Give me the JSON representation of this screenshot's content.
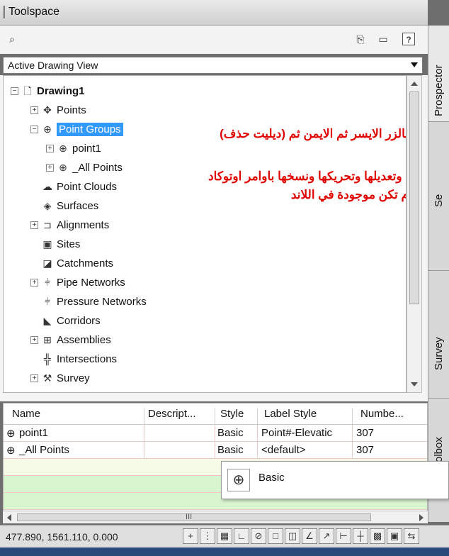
{
  "window": {
    "title": "Toolspace"
  },
  "toolbar": {
    "icons": [
      "search-icon",
      "copy-icon",
      "panel-icon",
      "help-icon"
    ],
    "help_label": "?"
  },
  "view_dropdown": {
    "value": "Active Drawing View"
  },
  "tree": {
    "root": {
      "label": "Drawing1",
      "toggle": "−"
    },
    "items": [
      {
        "label": "Points",
        "toggle": "+",
        "icon": "✥"
      },
      {
        "label": "Point Groups",
        "toggle": "−",
        "icon": "⊕"
      },
      {
        "label": "point1",
        "toggle": "+",
        "icon": "⊕"
      },
      {
        "label": "_All Points",
        "toggle": "+",
        "icon": "⊕"
      },
      {
        "label": "Point Clouds",
        "toggle": "",
        "icon": "☁"
      },
      {
        "label": "Surfaces",
        "toggle": "",
        "icon": "◈"
      },
      {
        "label": "Alignments",
        "toggle": "+",
        "icon": "⊐"
      },
      {
        "label": "Sites",
        "toggle": "",
        "icon": "▣"
      },
      {
        "label": "Catchments",
        "toggle": "",
        "icon": "◪"
      },
      {
        "label": "Pipe Networks",
        "toggle": "+",
        "icon": "⫩"
      },
      {
        "label": "Pressure Networks",
        "toggle": "",
        "icon": "⫩"
      },
      {
        "label": "Corridors",
        "toggle": "",
        "icon": "◣"
      },
      {
        "label": "Assemblies",
        "toggle": "+",
        "icon": "⊞"
      },
      {
        "label": "Intersections",
        "toggle": "",
        "icon": "╬"
      },
      {
        "label": "Survey",
        "toggle": "+",
        "icon": "⚒"
      }
    ]
  },
  "overlay_text": {
    "line1": "بالزر الايسر ثم الايمن ثم (ديليت حذف)",
    "line2": "ا وتعديلها وتحريكها ونسخها باوامر اوتوكاد",
    "line3": "م تكن موجودة في اللاند"
  },
  "side_tabs": {
    "prospector": "Prospector",
    "settings": "Se",
    "survey": "Survey",
    "toolbox": "olbox"
  },
  "grid": {
    "columns": [
      "Name",
      "Descript...",
      "Style",
      "Label Style",
      "Numbe..."
    ],
    "rows": [
      {
        "name": "point1",
        "description": "",
        "style": "Basic",
        "label_style": "Point#-Elevatic",
        "number": "307"
      },
      {
        "name": "_All Points",
        "description": "",
        "style": "Basic",
        "label_style": "<default>",
        "number": "307"
      }
    ],
    "scroll_label": "III"
  },
  "popup": {
    "label": "Basic"
  },
  "status": {
    "coordinates": "477.890, 1561.110, 0.000"
  },
  "colors": {
    "selection": "#3399ff",
    "overlay": "#e00000",
    "green_rows": "#d8f5d0"
  }
}
